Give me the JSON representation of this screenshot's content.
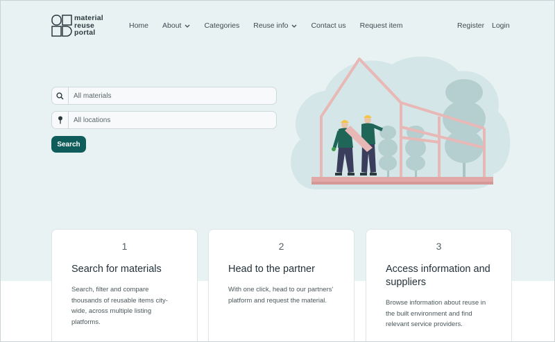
{
  "header": {
    "logo": {
      "line1": "material",
      "line2": "reuse",
      "line3": "portal"
    },
    "nav": [
      {
        "label": "Home",
        "dropdown": false
      },
      {
        "label": "About",
        "dropdown": true
      },
      {
        "label": "Categories",
        "dropdown": false
      },
      {
        "label": "Reuse info",
        "dropdown": true
      },
      {
        "label": "Contact us",
        "dropdown": false
      },
      {
        "label": "Request item",
        "dropdown": false
      }
    ],
    "register_label": "Register",
    "login_label": "Login"
  },
  "search": {
    "materials_placeholder": "All materials",
    "materials_icon": "search-icon",
    "locations_placeholder": "All locations",
    "locations_icon": "location-pin-icon",
    "button_label": "Search"
  },
  "steps": [
    {
      "number": "1",
      "title": "Search for materials",
      "description": "Search, filter and compare thousands of reusable items city-wide, across multiple listing platforms."
    },
    {
      "number": "2",
      "title": "Head to the partner",
      "description": "With one click, head to our partners' platform and request the material."
    },
    {
      "number": "3",
      "title": "Access information and suppliers",
      "description": "Browse information about reuse in the built environment and find relevant service providers."
    }
  ],
  "colors": {
    "accent": "#0f5d5a",
    "hero_background": "#e9f2f3",
    "frame_pink": "#e8b8b6"
  }
}
